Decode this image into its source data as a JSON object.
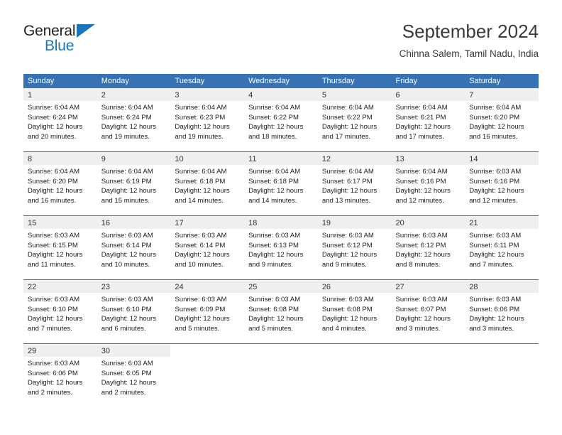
{
  "brand": {
    "line1": "General",
    "line2": "Blue",
    "triangle_color": "#1b75bb",
    "text_color": "#231f20"
  },
  "header": {
    "title": "September 2024",
    "subtitle": "Chinna Salem, Tamil Nadu, India"
  },
  "theme": {
    "header_blue": "#3672b4",
    "daynum_strip_gray": "#efefef",
    "body_white": "#ffffff",
    "text_dark": "#1c1c1c"
  },
  "calendar": {
    "weekday_headers": [
      "Sunday",
      "Monday",
      "Tuesday",
      "Wednesday",
      "Thursday",
      "Friday",
      "Saturday"
    ],
    "weeks": [
      [
        {
          "day": "1",
          "sunrise": "Sunrise: 6:04 AM",
          "sunset": "Sunset: 6:24 PM",
          "daylight1": "Daylight: 12 hours",
          "daylight2": "and 20 minutes."
        },
        {
          "day": "2",
          "sunrise": "Sunrise: 6:04 AM",
          "sunset": "Sunset: 6:24 PM",
          "daylight1": "Daylight: 12 hours",
          "daylight2": "and 19 minutes."
        },
        {
          "day": "3",
          "sunrise": "Sunrise: 6:04 AM",
          "sunset": "Sunset: 6:23 PM",
          "daylight1": "Daylight: 12 hours",
          "daylight2": "and 19 minutes."
        },
        {
          "day": "4",
          "sunrise": "Sunrise: 6:04 AM",
          "sunset": "Sunset: 6:22 PM",
          "daylight1": "Daylight: 12 hours",
          "daylight2": "and 18 minutes."
        },
        {
          "day": "5",
          "sunrise": "Sunrise: 6:04 AM",
          "sunset": "Sunset: 6:22 PM",
          "daylight1": "Daylight: 12 hours",
          "daylight2": "and 17 minutes."
        },
        {
          "day": "6",
          "sunrise": "Sunrise: 6:04 AM",
          "sunset": "Sunset: 6:21 PM",
          "daylight1": "Daylight: 12 hours",
          "daylight2": "and 17 minutes."
        },
        {
          "day": "7",
          "sunrise": "Sunrise: 6:04 AM",
          "sunset": "Sunset: 6:20 PM",
          "daylight1": "Daylight: 12 hours",
          "daylight2": "and 16 minutes."
        }
      ],
      [
        {
          "day": "8",
          "sunrise": "Sunrise: 6:04 AM",
          "sunset": "Sunset: 6:20 PM",
          "daylight1": "Daylight: 12 hours",
          "daylight2": "and 16 minutes."
        },
        {
          "day": "9",
          "sunrise": "Sunrise: 6:04 AM",
          "sunset": "Sunset: 6:19 PM",
          "daylight1": "Daylight: 12 hours",
          "daylight2": "and 15 minutes."
        },
        {
          "day": "10",
          "sunrise": "Sunrise: 6:04 AM",
          "sunset": "Sunset: 6:18 PM",
          "daylight1": "Daylight: 12 hours",
          "daylight2": "and 14 minutes."
        },
        {
          "day": "11",
          "sunrise": "Sunrise: 6:04 AM",
          "sunset": "Sunset: 6:18 PM",
          "daylight1": "Daylight: 12 hours",
          "daylight2": "and 14 minutes."
        },
        {
          "day": "12",
          "sunrise": "Sunrise: 6:04 AM",
          "sunset": "Sunset: 6:17 PM",
          "daylight1": "Daylight: 12 hours",
          "daylight2": "and 13 minutes."
        },
        {
          "day": "13",
          "sunrise": "Sunrise: 6:04 AM",
          "sunset": "Sunset: 6:16 PM",
          "daylight1": "Daylight: 12 hours",
          "daylight2": "and 12 minutes."
        },
        {
          "day": "14",
          "sunrise": "Sunrise: 6:03 AM",
          "sunset": "Sunset: 6:16 PM",
          "daylight1": "Daylight: 12 hours",
          "daylight2": "and 12 minutes."
        }
      ],
      [
        {
          "day": "15",
          "sunrise": "Sunrise: 6:03 AM",
          "sunset": "Sunset: 6:15 PM",
          "daylight1": "Daylight: 12 hours",
          "daylight2": "and 11 minutes."
        },
        {
          "day": "16",
          "sunrise": "Sunrise: 6:03 AM",
          "sunset": "Sunset: 6:14 PM",
          "daylight1": "Daylight: 12 hours",
          "daylight2": "and 10 minutes."
        },
        {
          "day": "17",
          "sunrise": "Sunrise: 6:03 AM",
          "sunset": "Sunset: 6:14 PM",
          "daylight1": "Daylight: 12 hours",
          "daylight2": "and 10 minutes."
        },
        {
          "day": "18",
          "sunrise": "Sunrise: 6:03 AM",
          "sunset": "Sunset: 6:13 PM",
          "daylight1": "Daylight: 12 hours",
          "daylight2": "and 9 minutes."
        },
        {
          "day": "19",
          "sunrise": "Sunrise: 6:03 AM",
          "sunset": "Sunset: 6:12 PM",
          "daylight1": "Daylight: 12 hours",
          "daylight2": "and 9 minutes."
        },
        {
          "day": "20",
          "sunrise": "Sunrise: 6:03 AM",
          "sunset": "Sunset: 6:12 PM",
          "daylight1": "Daylight: 12 hours",
          "daylight2": "and 8 minutes."
        },
        {
          "day": "21",
          "sunrise": "Sunrise: 6:03 AM",
          "sunset": "Sunset: 6:11 PM",
          "daylight1": "Daylight: 12 hours",
          "daylight2": "and 7 minutes."
        }
      ],
      [
        {
          "day": "22",
          "sunrise": "Sunrise: 6:03 AM",
          "sunset": "Sunset: 6:10 PM",
          "daylight1": "Daylight: 12 hours",
          "daylight2": "and 7 minutes."
        },
        {
          "day": "23",
          "sunrise": "Sunrise: 6:03 AM",
          "sunset": "Sunset: 6:10 PM",
          "daylight1": "Daylight: 12 hours",
          "daylight2": "and 6 minutes."
        },
        {
          "day": "24",
          "sunrise": "Sunrise: 6:03 AM",
          "sunset": "Sunset: 6:09 PM",
          "daylight1": "Daylight: 12 hours",
          "daylight2": "and 5 minutes."
        },
        {
          "day": "25",
          "sunrise": "Sunrise: 6:03 AM",
          "sunset": "Sunset: 6:08 PM",
          "daylight1": "Daylight: 12 hours",
          "daylight2": "and 5 minutes."
        },
        {
          "day": "26",
          "sunrise": "Sunrise: 6:03 AM",
          "sunset": "Sunset: 6:08 PM",
          "daylight1": "Daylight: 12 hours",
          "daylight2": "and 4 minutes."
        },
        {
          "day": "27",
          "sunrise": "Sunrise: 6:03 AM",
          "sunset": "Sunset: 6:07 PM",
          "daylight1": "Daylight: 12 hours",
          "daylight2": "and 3 minutes."
        },
        {
          "day": "28",
          "sunrise": "Sunrise: 6:03 AM",
          "sunset": "Sunset: 6:06 PM",
          "daylight1": "Daylight: 12 hours",
          "daylight2": "and 3 minutes."
        }
      ],
      [
        {
          "day": "29",
          "sunrise": "Sunrise: 6:03 AM",
          "sunset": "Sunset: 6:06 PM",
          "daylight1": "Daylight: 12 hours",
          "daylight2": "and 2 minutes."
        },
        {
          "day": "30",
          "sunrise": "Sunrise: 6:03 AM",
          "sunset": "Sunset: 6:05 PM",
          "daylight1": "Daylight: 12 hours",
          "daylight2": "and 2 minutes."
        },
        {
          "day": "",
          "sunrise": "",
          "sunset": "",
          "daylight1": "",
          "daylight2": ""
        },
        {
          "day": "",
          "sunrise": "",
          "sunset": "",
          "daylight1": "",
          "daylight2": ""
        },
        {
          "day": "",
          "sunrise": "",
          "sunset": "",
          "daylight1": "",
          "daylight2": ""
        },
        {
          "day": "",
          "sunrise": "",
          "sunset": "",
          "daylight1": "",
          "daylight2": ""
        },
        {
          "day": "",
          "sunrise": "",
          "sunset": "",
          "daylight1": "",
          "daylight2": ""
        }
      ]
    ]
  }
}
